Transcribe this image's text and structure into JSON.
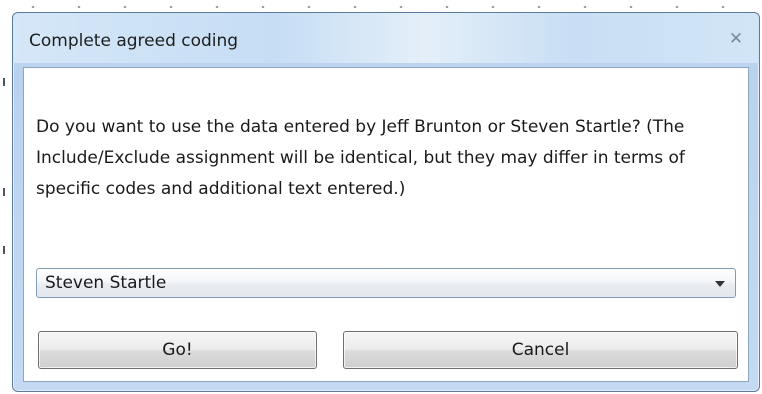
{
  "dialog": {
    "title": "Complete agreed coding",
    "close_icon": "✕",
    "message": "Do you want to use the data entered by Jeff Brunton or Steven Startle? (The Include/Exclude assignment will be identical, but they may differ in terms of specific codes and additional text entered.)",
    "selector": {
      "selected": "Steven Startle"
    },
    "buttons": {
      "go_label": "Go!",
      "cancel_label": "Cancel"
    }
  }
}
